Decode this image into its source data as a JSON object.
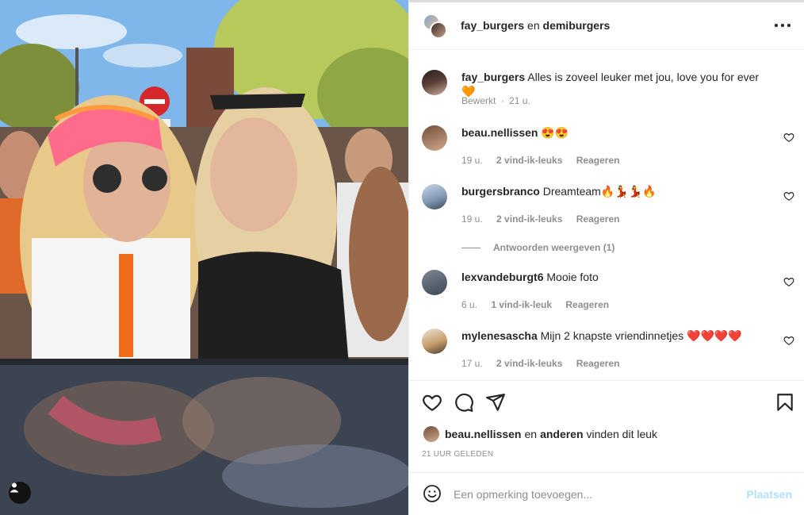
{
  "post": {
    "authors": {
      "user1": "fay_burgers",
      "joiner": "en",
      "user2": "demiburgers"
    }
  },
  "caption": {
    "username": "fay_burgers",
    "text": "Alles is zoveel leuker met jou, love you for ever 🧡",
    "edited": "Bewerkt",
    "sep": "·",
    "time": "21 u."
  },
  "comments": [
    {
      "username": "beau.nellissen",
      "text": "😍😍",
      "time": "19 u.",
      "likes": "2 vind-ik-leuks",
      "reply": "Reageren"
    },
    {
      "username": "burgersbranco",
      "text": "Dreamteam🔥💃💃🔥",
      "time": "19 u.",
      "likes": "2 vind-ik-leuks",
      "reply": "Reageren"
    },
    {
      "username": "lexvandeburgt6",
      "text": "Mooie foto",
      "time": "6 u.",
      "likes": "1 vind-ik-leuk",
      "reply": "Reageren"
    },
    {
      "username": "mylenesascha",
      "text": "Mijn 2 knapste vriendinnetjes ❤️❤️❤️❤️",
      "time": "17 u.",
      "likes": "2 vind-ik-leuks",
      "reply": "Reageren"
    }
  ],
  "view_replies": "Antwoorden weergeven (1)",
  "likes": {
    "user": "beau.nellissen",
    "joiner": "en",
    "others": "anderen",
    "suffix": "vinden dit leuk"
  },
  "timestamp": "21 UUR GELEDEN",
  "add_comment": {
    "placeholder": "Een opmerking toevoegen...",
    "post_label": "Plaatsen"
  },
  "icons": {
    "more": "more-horizontal-icon",
    "like": "heart-icon",
    "comment": "comment-bubble-icon",
    "share": "paper-plane-icon",
    "save": "bookmark-icon",
    "emoji": "smiley-icon",
    "user_tag": "user-tag-icon"
  },
  "colors": {
    "post_button_disabled": "#b2dffc",
    "meta_text": "#8e8e8e",
    "text": "#262626"
  }
}
